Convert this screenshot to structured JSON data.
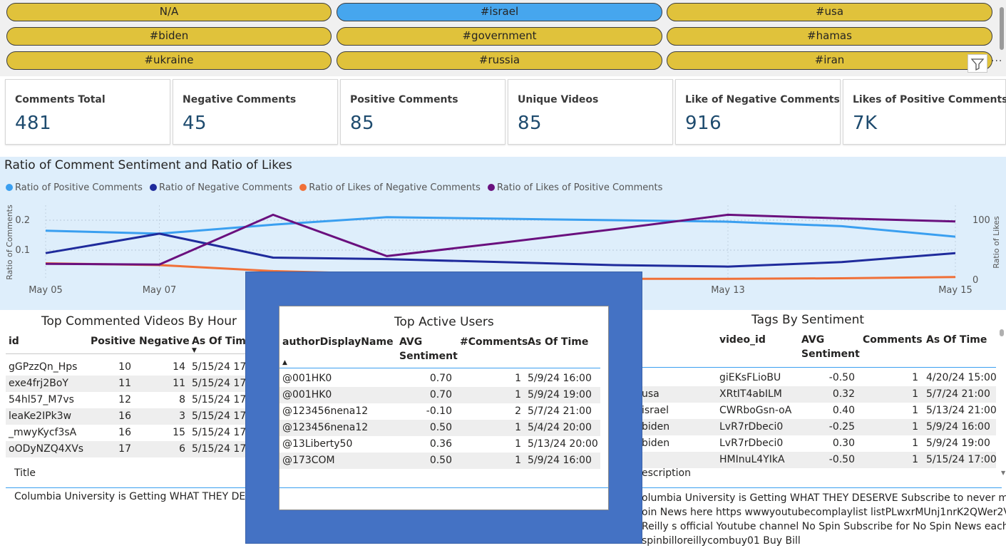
{
  "slicer": {
    "options": [
      {
        "label": "N/A",
        "selected": false
      },
      {
        "label": "#israel",
        "selected": true
      },
      {
        "label": "#usa",
        "selected": false
      },
      {
        "label": "#biden",
        "selected": false
      },
      {
        "label": "#government",
        "selected": false
      },
      {
        "label": "#hamas",
        "selected": false
      },
      {
        "label": "#ukraine",
        "selected": false
      },
      {
        "label": "#russia",
        "selected": false
      },
      {
        "label": "#iran",
        "selected": false
      }
    ],
    "more_label": "···"
  },
  "kpis": [
    {
      "label": "Comments Total",
      "value": "481"
    },
    {
      "label": "Negative Comments",
      "value": "45"
    },
    {
      "label": "Positive Comments",
      "value": "85"
    },
    {
      "label": "Unique Videos",
      "value": "85"
    },
    {
      "label": "Like of Negative Comments",
      "value": "916"
    },
    {
      "label": "Likes of Positive Comments",
      "value": "7K"
    }
  ],
  "chart_data": {
    "type": "line",
    "title": "Ratio of Comment Sentiment and Ratio of Likes",
    "ylabel": "Ratio of Comments",
    "y2label": "Ratio of Likes",
    "x": [
      "May 05",
      "May 07",
      "May 08",
      "May 09",
      "May 10",
      "May 11",
      "May 13",
      "May 14",
      "May 15"
    ],
    "x_ticks": [
      "May 05",
      "May 07",
      "May 13",
      "May 15"
    ],
    "y_ticks": [
      "0.1",
      "0.2"
    ],
    "y2_ticks": [
      "0",
      "100"
    ],
    "ylim": [
      0,
      0.25
    ],
    "y2lim": [
      0,
      125
    ],
    "grid": true,
    "legend_position": "top-left",
    "series": [
      {
        "name": "Ratio of Positive Comments",
        "axis": "left",
        "color": "#3a9ff0",
        "values": [
          0.165,
          0.155,
          0.185,
          0.21,
          0.205,
          0.2,
          0.195,
          0.18,
          0.145
        ]
      },
      {
        "name": "Ratio of Negative Comments",
        "axis": "left",
        "color": "#1f2b9c",
        "values": [
          0.09,
          0.155,
          0.075,
          0.07,
          0.06,
          0.05,
          0.045,
          0.06,
          0.09
        ]
      },
      {
        "name": "Ratio of Likes of Negative Comments",
        "axis": "right",
        "color": "#f07038",
        "values": [
          28,
          25,
          15,
          10,
          5,
          2,
          2,
          3,
          5
        ]
      },
      {
        "name": "Ratio of Likes of Positive Comments",
        "axis": "right",
        "color": "#6a107e",
        "values": [
          27,
          26,
          109,
          40,
          62,
          85,
          109,
          103,
          98
        ]
      }
    ]
  },
  "videos_table": {
    "title": "Top Commented Videos By Hour",
    "columns": [
      "id",
      "Positive",
      "Negative",
      "As Of Time"
    ],
    "rows": [
      [
        "gGPzzQn_Hps",
        "10",
        "14",
        "5/15/24 17:"
      ],
      [
        "exe4frj2BoY",
        "11",
        "11",
        "5/15/24 17:"
      ],
      [
        "54hl57_M7vs",
        "12",
        "8",
        "5/15/24 17:"
      ],
      [
        "leaKe2IPk3w",
        "16",
        "3",
        "5/15/24 17:"
      ],
      [
        "_mwyKycf3sA",
        "16",
        "15",
        "5/15/24 17:"
      ],
      [
        "oODyNZQ4XVs",
        "17",
        "6",
        "5/15/24 17:"
      ]
    ]
  },
  "title_panel": {
    "header": "Title",
    "text": "Columbia University is Getting WHAT THEY DESER"
  },
  "tags_table": {
    "title": "Tags By Sentiment",
    "columns": [
      "",
      "video_id",
      "AVG Sentiment",
      "Comments",
      "As Of Time"
    ],
    "rows": [
      [
        "",
        "giEKsFLioBU",
        "-0.50",
        "1",
        "4/20/24 15:00"
      ],
      [
        "usa",
        "XRtIT4abILM",
        "0.32",
        "1",
        "5/7/24 21:00"
      ],
      [
        "israel",
        "CWRboGsn-oA",
        "0.40",
        "1",
        "5/13/24 21:00"
      ],
      [
        "biden",
        "LvR7rDbeci0",
        "-0.25",
        "1",
        "5/9/24 16:00"
      ],
      [
        "biden",
        "LvR7rDbeci0",
        "0.30",
        "1",
        "5/9/24 19:00"
      ],
      [
        "",
        "HMInuL4YIkA",
        "-0.50",
        "1",
        "5/15/24 17:00"
      ]
    ]
  },
  "description_panel": {
    "header": "escription",
    "lines": [
      "olumbia University is Getting WHAT THEY DESERVE Subscribe to never miss an",
      "oin News here https wwwyoutubecomplaylist listPLwxrMUnj1nrK2QWer2Vxbar",
      "Reilly s official Youtube channel No Spin Subscribe for No Spin News each nig",
      "spinbilloreillycombuy01 Buy Bill"
    ]
  },
  "users_popup": {
    "title": "Top Active Users",
    "columns": [
      "authorDisplayName",
      "AVG Sentiment",
      "#Comments",
      "As Of Time"
    ],
    "rows": [
      [
        "@001HK0",
        "0.70",
        "1",
        "5/9/24 16:00"
      ],
      [
        "@001HK0",
        "0.70",
        "1",
        "5/9/24 19:00"
      ],
      [
        "@123456nena12",
        "-0.10",
        "2",
        "5/7/24 21:00"
      ],
      [
        "@123456nena12",
        "0.50",
        "1",
        "5/4/24 20:00"
      ],
      [
        "@13Liberty50",
        "0.36",
        "1",
        "5/13/24 20:00"
      ],
      [
        "@173COM",
        "0.50",
        "1",
        "5/9/24 16:00"
      ]
    ]
  }
}
